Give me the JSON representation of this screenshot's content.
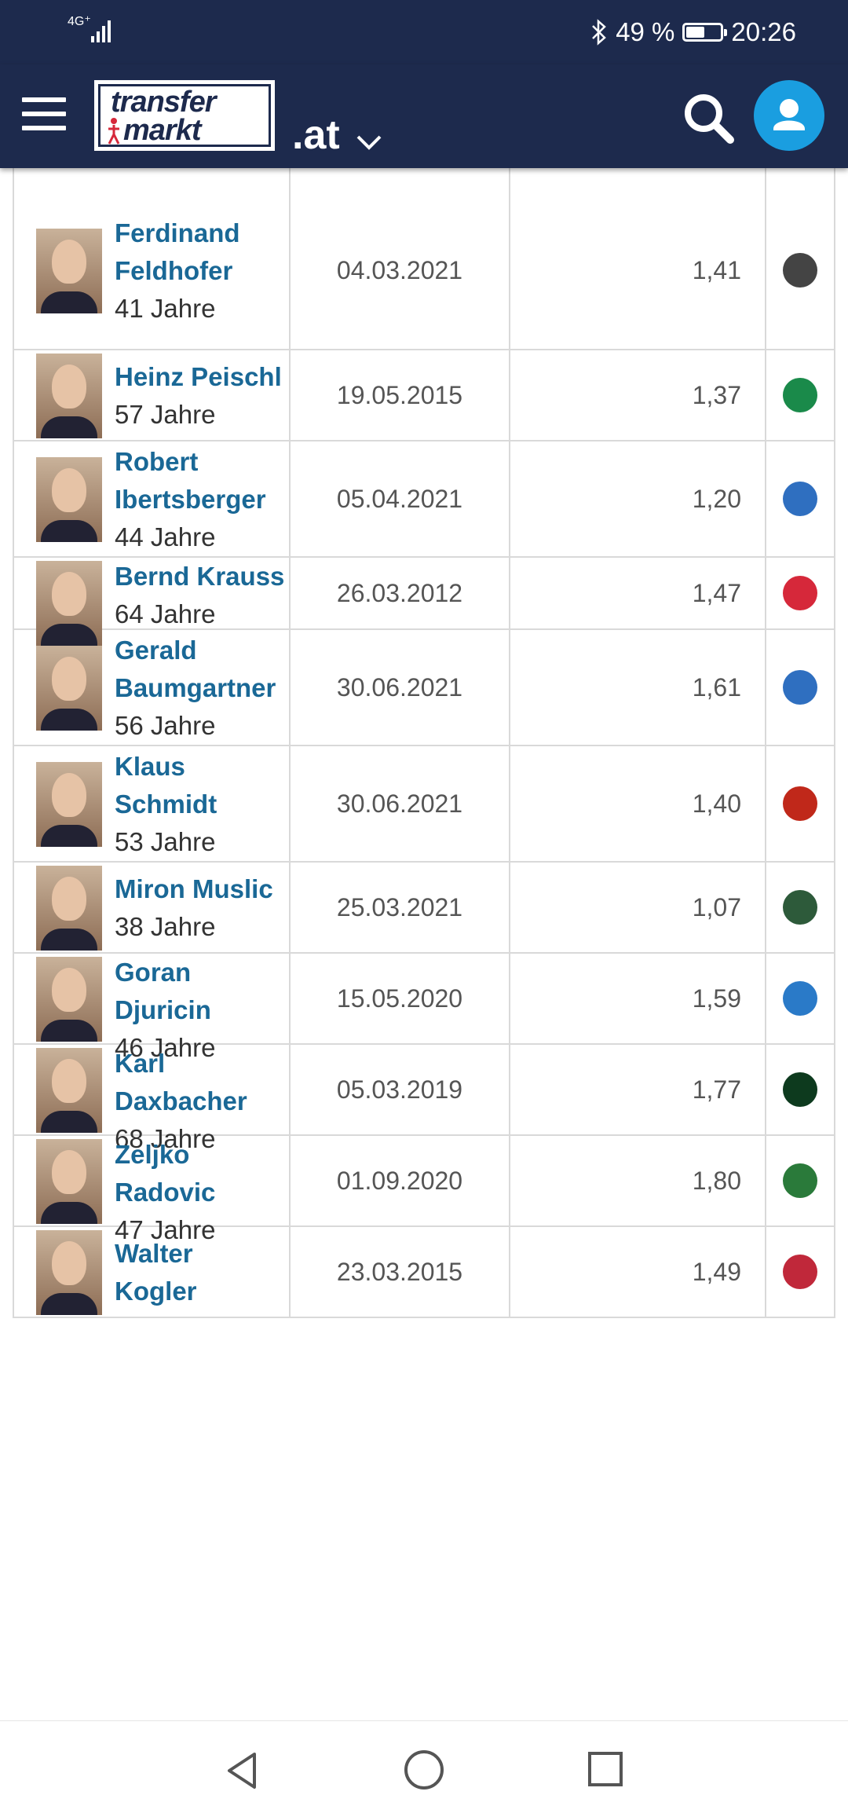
{
  "status_bar": {
    "network": "4G⁺",
    "bluetooth_icon": "bluetooth-icon",
    "battery_percent": "49 %",
    "battery_level": 0.49,
    "time": "20:26"
  },
  "header": {
    "logo_line1": "transfer",
    "logo_line2": "markt",
    "domain": ".at",
    "colors": {
      "background": "#1d2a4d",
      "accent": "#1a9ee0"
    }
  },
  "rows": [
    {
      "name_lines": [
        "Ferdinand",
        "Feldhofer"
      ],
      "age": "41 Jahre",
      "date": "04.03.2021",
      "ppm": "1,41",
      "club_color": "#444444"
    },
    {
      "name_lines": [
        "Heinz Peischl"
      ],
      "age": "57 Jahre",
      "date": "19.05.2015",
      "ppm": "1,37",
      "club_color": "#1a8a4a"
    },
    {
      "name_lines": [
        "Robert",
        "Ibertsberger"
      ],
      "age": "44 Jahre",
      "date": "05.04.2021",
      "ppm": "1,20",
      "club_color": "#2f6fc0"
    },
    {
      "name_lines": [
        "Bernd Krauss"
      ],
      "age": "64 Jahre",
      "date": "26.03.2012",
      "ppm": "1,47",
      "club_color": "#d6283a"
    },
    {
      "name_lines": [
        "Gerald",
        "Baumgartner"
      ],
      "age": "56 Jahre",
      "date": "30.06.2021",
      "ppm": "1,61",
      "club_color": "#2f6fc0"
    },
    {
      "name_lines": [
        "Klaus",
        "Schmidt"
      ],
      "age": "53 Jahre",
      "date": "30.06.2021",
      "ppm": "1,40",
      "club_color": "#c0281a"
    },
    {
      "name_lines": [
        "Miron Muslic"
      ],
      "age": "38 Jahre",
      "date": "25.03.2021",
      "ppm": "1,07",
      "club_color": "#2d5a3a"
    },
    {
      "name_lines": [
        "Goran",
        "Djuricin"
      ],
      "age": "46 Jahre",
      "date": "15.05.2020",
      "ppm": "1,59",
      "club_color": "#2a7ac8"
    },
    {
      "name_lines": [
        "Karl",
        "Daxbacher"
      ],
      "age": "68 Jahre",
      "date": "05.03.2019",
      "ppm": "1,77",
      "club_color": "#0d3a1e"
    },
    {
      "name_lines": [
        "Zeljko",
        "Radovic"
      ],
      "age": "47 Jahre",
      "date": "01.09.2020",
      "ppm": "1,80",
      "club_color": "#2a7a3a"
    },
    {
      "name_lines": [
        "Walter",
        "Kogler"
      ],
      "age": "",
      "date": "23.03.2015",
      "ppm": "1,49",
      "club_color": "#c0283a"
    }
  ]
}
